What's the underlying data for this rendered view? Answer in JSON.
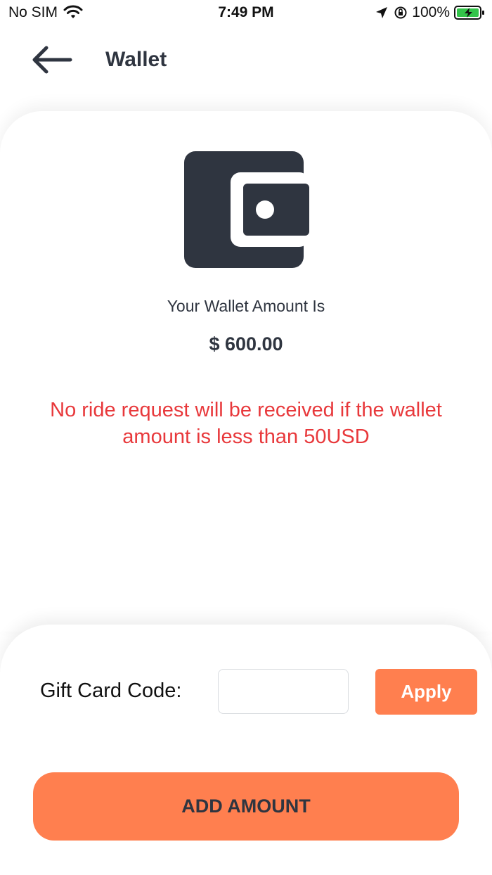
{
  "status_bar": {
    "carrier": "No SIM",
    "time": "7:49 PM",
    "battery_percent": "100%"
  },
  "header": {
    "title": "Wallet",
    "back_icon": "arrow-left-icon"
  },
  "wallet": {
    "icon": "wallet-icon",
    "amount_label": "Your Wallet Amount Is",
    "amount_value": "$ 600.00",
    "warning": "No ride request will be received if the wallet amount is less than 50USD"
  },
  "gift_card": {
    "label": "Gift Card Code:",
    "value": "",
    "placeholder": "",
    "apply_label": "Apply"
  },
  "actions": {
    "add_amount_label": "ADD AMOUNT"
  },
  "colors": {
    "accent": "#ff7f4f",
    "warning": "#e8383b",
    "dark": "#2f3540"
  }
}
